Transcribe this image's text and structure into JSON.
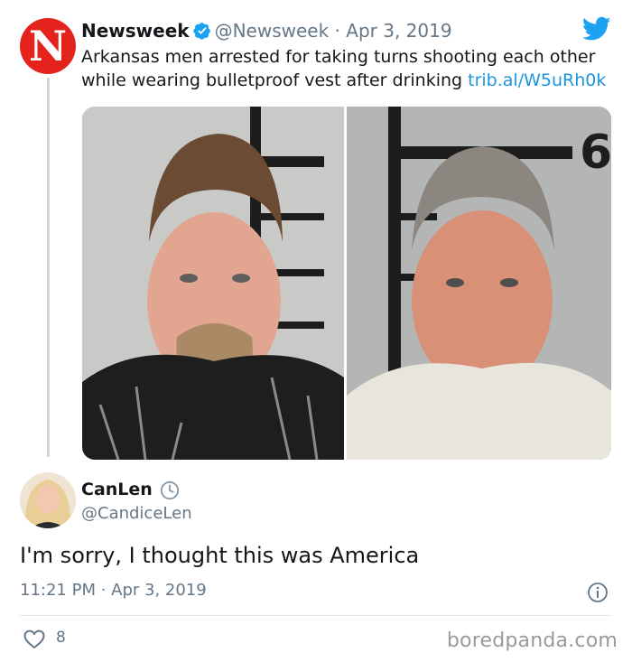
{
  "quoted_tweet": {
    "avatar_letter": "N",
    "name": "Newsweek",
    "handle": "@Newsweek",
    "separator": "·",
    "date": "Apr 3, 2019",
    "text": "Arkansas men arrested for taking turns shooting each other while wearing bulletproof vest after drinking",
    "link": "trib.al/W5uRh0k",
    "brand_color": "#e3231c",
    "verified_icon": "verified-badge-icon",
    "platform_icon": "twitter-bird-icon",
    "mugshot_height_label": "6'"
  },
  "reply_tweet": {
    "name": "CanLen",
    "handle": "@CandiceLen",
    "status_icon": "clock-icon",
    "text": "I'm sorry, I thought this was America",
    "timestamp": "11:21 PM · Apr 3, 2019",
    "likes": "8",
    "info_icon": "info-icon",
    "like_icon": "heart-icon"
  },
  "watermark": "boredpanda.com",
  "colors": {
    "link": "#1b95e0",
    "muted": "#657786",
    "text": "#14171a"
  }
}
